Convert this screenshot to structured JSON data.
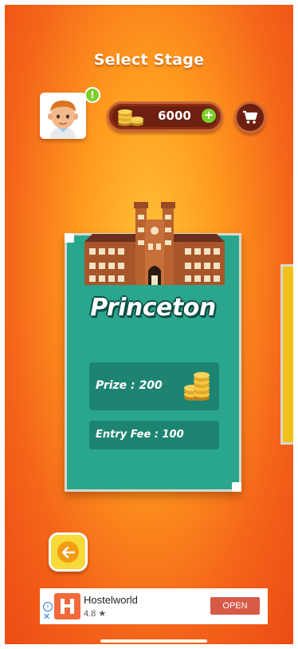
{
  "header": {
    "title": "Select Stage"
  },
  "player": {
    "notification_badge": "!"
  },
  "wallet": {
    "coins": "6000",
    "add_label": "+"
  },
  "stage": {
    "name": "Princeton",
    "prize_label": "Prize : 200",
    "entry_fee_label": "Entry Fee : 100"
  },
  "ad": {
    "app_name": "Hostelworld",
    "rating": "4.8 ★",
    "cta": "OPEN"
  },
  "colors": {
    "background": "#f4641a",
    "card": "#2aa68c",
    "card_panel": "#1e8472",
    "accent_green": "#7ccf2c",
    "wallet_bg": "#6d2010",
    "back_button": "#f7d93a"
  },
  "icons": {
    "cart": "shopping-cart-icon",
    "back": "arrow-left-icon",
    "coins": "coin-stack-icon",
    "add": "plus-icon"
  }
}
